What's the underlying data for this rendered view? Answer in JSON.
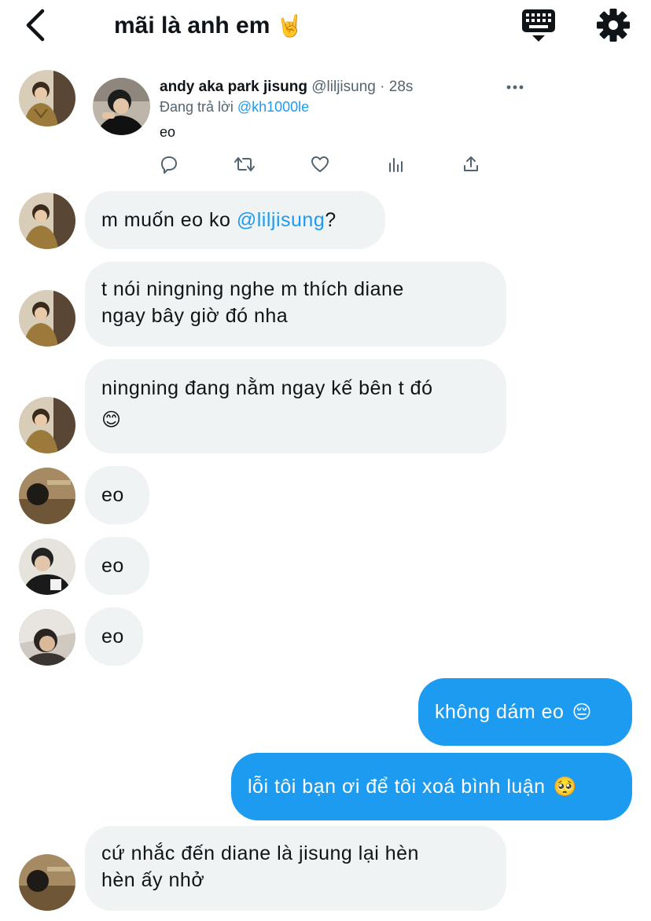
{
  "header": {
    "title": "mãi là anh em",
    "title_emoji": "🤘",
    "back_icon": "chevron-left-icon",
    "keyboard_icon": "keyboard-icon",
    "settings_icon": "gear-icon"
  },
  "tweet": {
    "name": "andy aka park jisung",
    "handle": "@liljisung",
    "time": "· 28s",
    "reply_prefix": "Đang trả lời",
    "reply_to": "@kh1000le",
    "text": "eo",
    "more_icon": "more-dots-icon",
    "actions": [
      "reply-icon",
      "retweet-icon",
      "like-icon",
      "analytics-icon",
      "share-icon"
    ]
  },
  "messages": [
    {
      "text_before": "m muốn eo ko ",
      "mention": "@liljisung",
      "text_after": "?"
    },
    {
      "line1": "t nói ningning nghe m thích diane",
      "line2": "ngay bây giờ đó nha"
    },
    {
      "line1": "ningning đang nằm ngay kế bên t đó",
      "emoji": "😊"
    },
    {
      "text": "eo"
    },
    {
      "text": "eo"
    },
    {
      "text": "eo"
    },
    {
      "text": "không dám eo",
      "emoji": "😔",
      "mine": true
    },
    {
      "text": "lỗi tôi bạn ơi để tôi xoá bình luận",
      "emoji": "🥺",
      "mine": true
    },
    {
      "line1": "cứ nhắc đến diane là jisung lại hèn",
      "line2": "hèn ấy nhở"
    }
  ],
  "colors": {
    "accent": "#1d9bf0",
    "bubble_gray": "#eff3f4",
    "text": "#0f1419",
    "secondary": "#536471"
  }
}
